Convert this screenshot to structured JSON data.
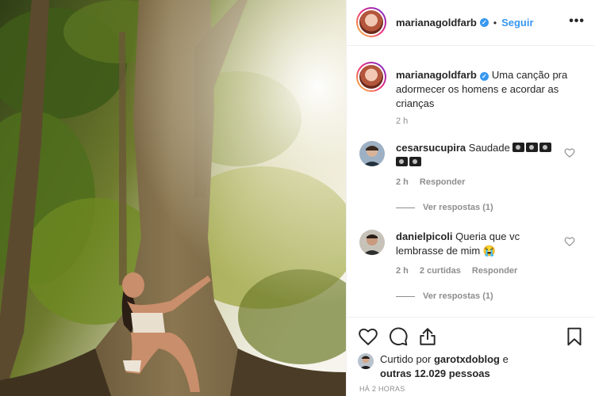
{
  "post": {
    "author": "marianagoldfarb",
    "follow_label": "Seguir",
    "separator": "•",
    "more_icon": "more-options-icon",
    "caption": "Uma canção pra adormecer os homens e acordar as crianças",
    "caption_time": "2 h"
  },
  "comments": [
    {
      "username": "cesarsucupira",
      "text": "Saudade",
      "emoji": "camera-with-flash x5",
      "time": "2 h",
      "reply_label": "Responder",
      "view_replies": "Ver respostas (1)"
    },
    {
      "username": "danielpicoli",
      "text": "Queria que vc lembrasse de mim",
      "emoji": "crying-face",
      "emoji_char": "😭",
      "time": "2 h",
      "likes": "2 curtidas",
      "reply_label": "Responder",
      "view_replies": "Ver respostas (1)"
    }
  ],
  "likes": {
    "prefix": "Curtido por",
    "liker": "garotxdoblog",
    "connector": "e",
    "others": "outras 12.029 pessoas"
  },
  "timestamp": "HÁ 2 HORAS",
  "icons": [
    "like-icon",
    "comment-icon",
    "share-icon",
    "save-icon",
    "heart-icon",
    "verified-badge-icon"
  ],
  "colors": {
    "link_blue": "#3897f0",
    "muted_gray": "#8e8e8e",
    "text": "#262626",
    "border": "#efefef"
  }
}
